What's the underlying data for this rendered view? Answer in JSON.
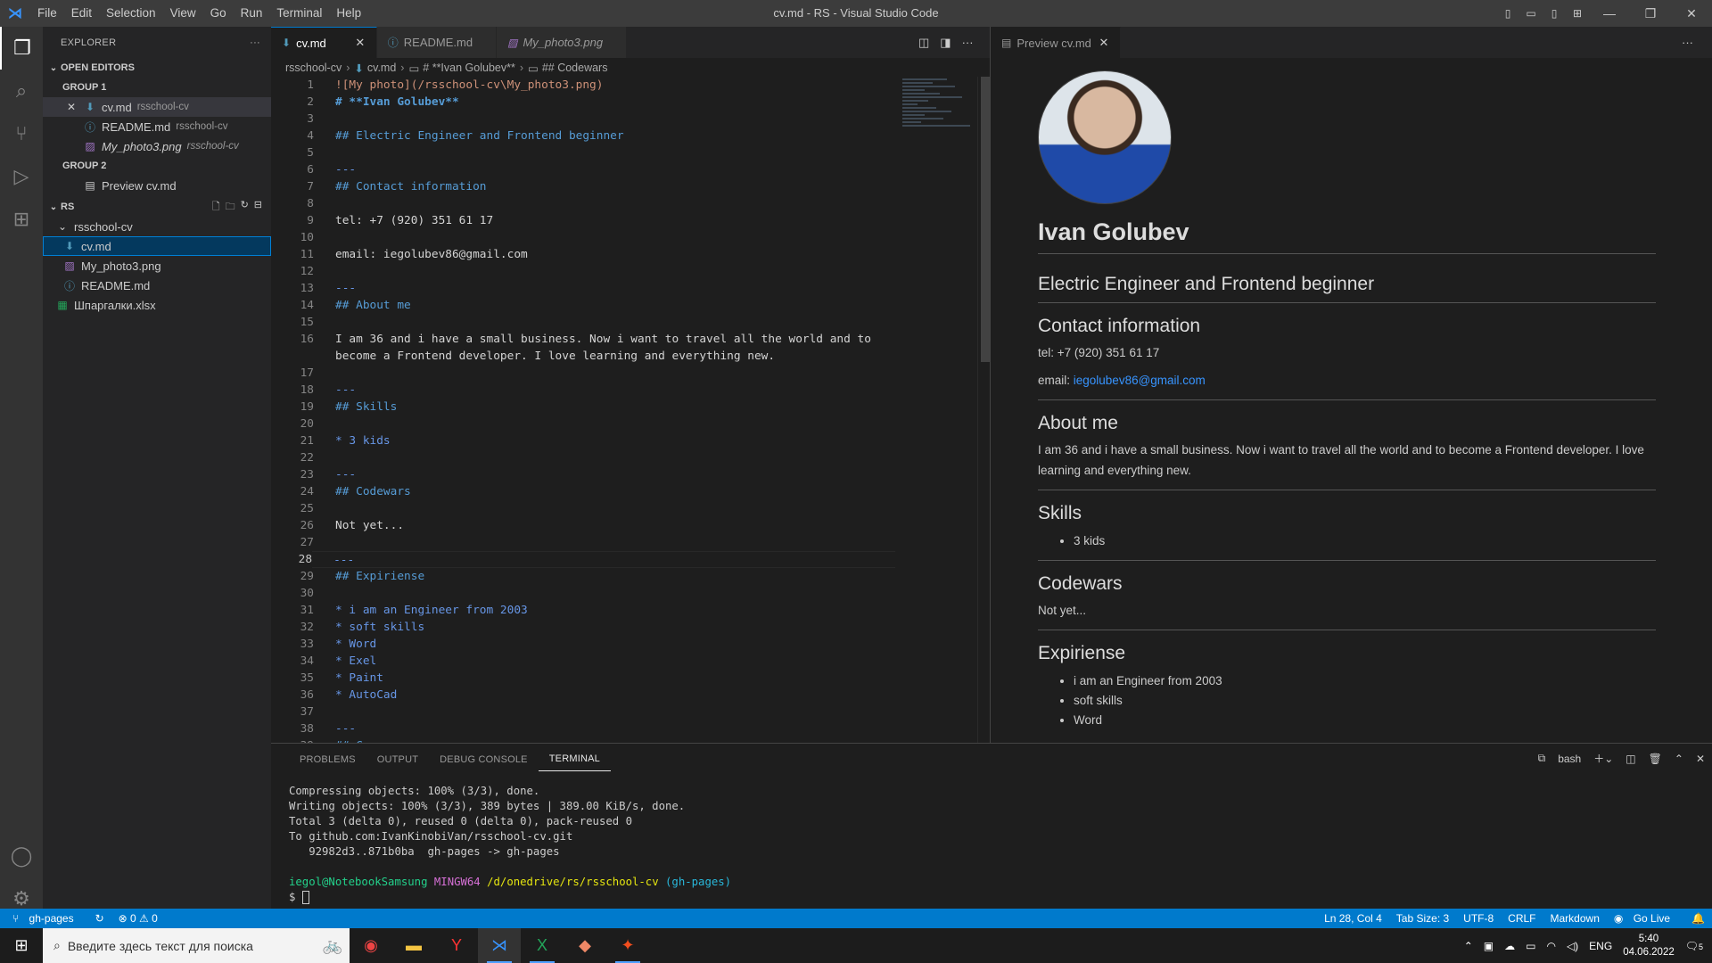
{
  "window": {
    "title": "cv.md - RS - Visual Studio Code"
  },
  "menu": [
    "File",
    "Edit",
    "Selection",
    "View",
    "Go",
    "Run",
    "Terminal",
    "Help"
  ],
  "sidebar": {
    "title": "EXPLORER",
    "open_editors": {
      "label": "OPEN EDITORS",
      "group1": "GROUP 1",
      "group2": "GROUP 2",
      "items": [
        {
          "name": "cv.md",
          "desc": "rsschool-cv"
        },
        {
          "name": "README.md",
          "desc": "rsschool-cv"
        },
        {
          "name": "My_photo3.png",
          "desc": "rsschool-cv"
        }
      ],
      "group2_items": [
        {
          "name": "Preview cv.md"
        }
      ]
    },
    "workspace": {
      "label": "RS",
      "folder": "rsschool-cv",
      "files": [
        "cv.md",
        "My_photo3.png",
        "README.md"
      ],
      "root_file": "Шпаргалки.xlsx"
    }
  },
  "tabs": [
    {
      "label": "cv.md",
      "active": true
    },
    {
      "label": "README.md"
    },
    {
      "label": "My_photo3.png"
    }
  ],
  "preview_tab": {
    "label": "Preview cv.md"
  },
  "breadcrumb": [
    "rsschool-cv",
    "cv.md",
    "# **Ivan Golubev**",
    "## Codewars"
  ],
  "code_lines": [
    {
      "n": "1",
      "text": "![My photo](/rsschool-cv\\My_photo3.png)"
    },
    {
      "n": "2",
      "text": "# **Ivan Golubev**"
    },
    {
      "n": "3",
      "text": ""
    },
    {
      "n": "4",
      "text": "## Electric Engineer and Frontend beginner"
    },
    {
      "n": "5",
      "text": ""
    },
    {
      "n": "6",
      "text": "---"
    },
    {
      "n": "7",
      "text": "## Contact information"
    },
    {
      "n": "8",
      "text": ""
    },
    {
      "n": "9",
      "text": "tel: +7 (920) 351 61 17"
    },
    {
      "n": "10",
      "text": ""
    },
    {
      "n": "11",
      "text": "email: iegolubev86@gmail.com"
    },
    {
      "n": "12",
      "text": ""
    },
    {
      "n": "13",
      "text": "---"
    },
    {
      "n": "14",
      "text": "## About me"
    },
    {
      "n": "15",
      "text": ""
    },
    {
      "n": "16",
      "text": "I am 36 and i have a small business. Now i want to travel all the world and to"
    },
    {
      "n": "",
      "text": "become a Frontend developer. I love learning and everything new."
    },
    {
      "n": "17",
      "text": ""
    },
    {
      "n": "18",
      "text": "---"
    },
    {
      "n": "19",
      "text": "## Skills"
    },
    {
      "n": "20",
      "text": ""
    },
    {
      "n": "21",
      "text": "* 3 kids"
    },
    {
      "n": "22",
      "text": ""
    },
    {
      "n": "23",
      "text": "---"
    },
    {
      "n": "24",
      "text": "## Codewars"
    },
    {
      "n": "25",
      "text": ""
    },
    {
      "n": "26",
      "text": "Not yet..."
    },
    {
      "n": "27",
      "text": ""
    },
    {
      "n": "28",
      "text": "---"
    },
    {
      "n": "29",
      "text": "## Expiriense"
    },
    {
      "n": "30",
      "text": ""
    },
    {
      "n": "31",
      "text": "* i am an Engineer from 2003"
    },
    {
      "n": "32",
      "text": "* soft skills"
    },
    {
      "n": "33",
      "text": "* Word"
    },
    {
      "n": "34",
      "text": "* Exel"
    },
    {
      "n": "35",
      "text": "* Paint"
    },
    {
      "n": "36",
      "text": "* AutoCad"
    },
    {
      "n": "37",
      "text": ""
    },
    {
      "n": "38",
      "text": "---"
    },
    {
      "n": "39",
      "text": "## C..."
    }
  ],
  "preview": {
    "name": "Ivan Golubev",
    "subtitle": "Electric Engineer and Frontend beginner",
    "contact_h": "Contact information",
    "tel": "tel: +7 (920) 351 61 17",
    "email_label": "email: ",
    "email": "iegolubev86@gmail.com",
    "about_h": "About me",
    "about": "I am 36 and i have a small business. Now i want to travel all the world and to become a Frontend developer. I love learning and everything new.",
    "skills_h": "Skills",
    "skills": [
      "3 kids"
    ],
    "codewars_h": "Codewars",
    "codewars": "Not yet...",
    "exp_h": "Expiriense",
    "exp": [
      "i am an Engineer from 2003",
      "soft skills",
      "Word"
    ]
  },
  "panel": {
    "tabs": [
      "PROBLEMS",
      "OUTPUT",
      "DEBUG CONSOLE",
      "TERMINAL"
    ],
    "shell": "bash",
    "lines": [
      "Compressing objects: 100% (3/3), done.",
      "Writing objects: 100% (3/3), 389 bytes | 389.00 KiB/s, done.",
      "Total 3 (delta 0), reused 0 (delta 0), pack-reused 0",
      "To github.com:IvanKinobiVan/rsschool-cv.git",
      "   92982d3..871b0ba  gh-pages -> gh-pages"
    ],
    "prompt_user": "iegol@NotebookSamsung",
    "prompt_env": "MINGW64",
    "prompt_path": "/d/onedrive/rs/rsschool-cv",
    "prompt_branch": "(gh-pages)",
    "prompt_symbol": "$"
  },
  "status": {
    "branch": "gh-pages",
    "problems": "⊗ 0 ⚠ 0",
    "position": "Ln 28, Col 4",
    "tabsize": "Tab Size: 3",
    "encoding": "UTF-8",
    "eol": "CRLF",
    "language": "Markdown",
    "golive": "Go Live"
  },
  "taskbar": {
    "search_placeholder": "Введите здесь текст для поиска",
    "lang": "ENG",
    "time": "5:40",
    "date": "04.06.2022",
    "notif": "5"
  }
}
